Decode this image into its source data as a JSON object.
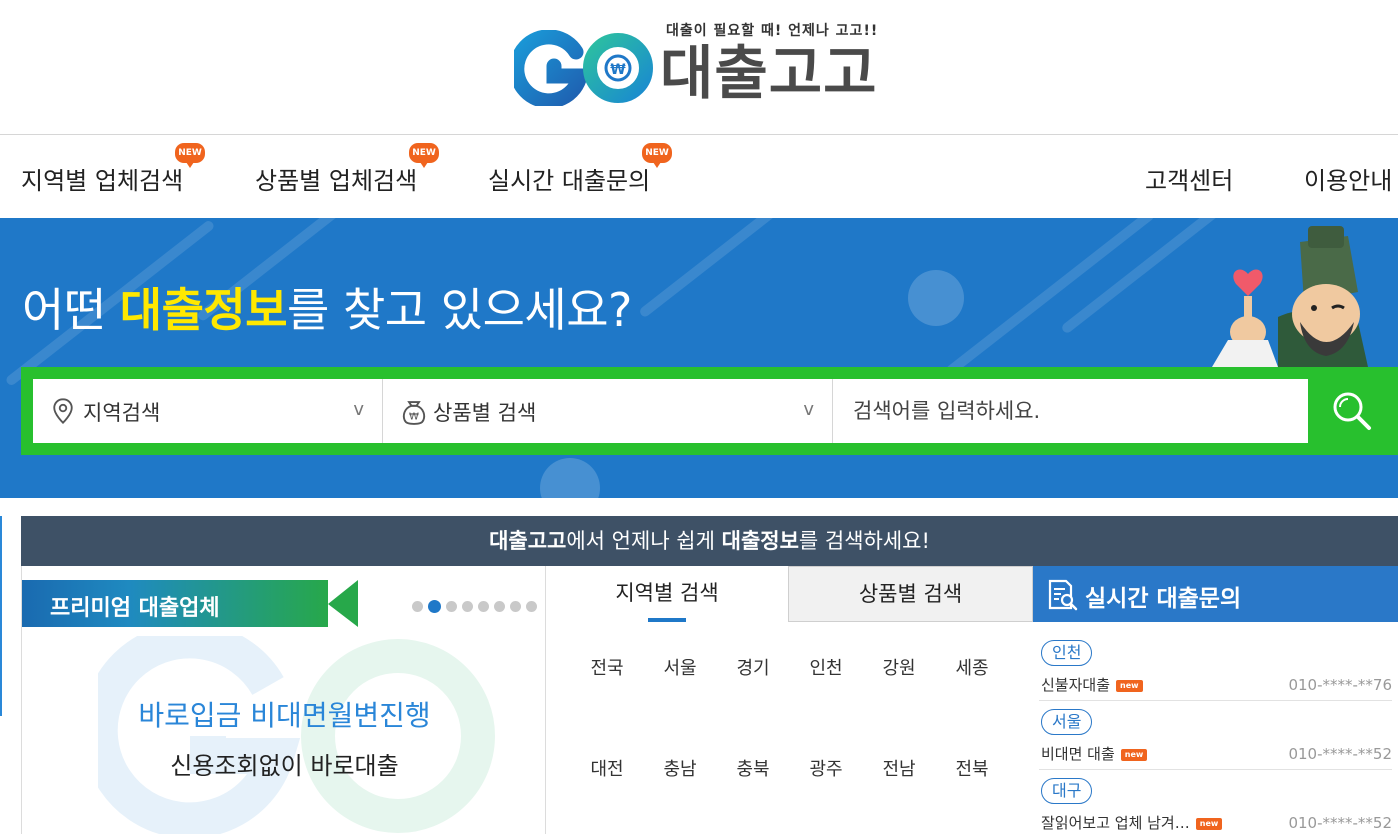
{
  "logo": {
    "mark": "GO",
    "name": "대출고고",
    "tagline": "대출이 필요할 때! 언제나 고고!!"
  },
  "nav": {
    "left_items": [
      {
        "label": "지역별 업체검색",
        "badge": "NEW"
      },
      {
        "label": "상품별 업체검색",
        "badge": "NEW"
      },
      {
        "label": "실시간 대출문의",
        "badge": "NEW"
      }
    ],
    "right_items": [
      {
        "label": "고객센터"
      },
      {
        "label": "이용안내"
      }
    ]
  },
  "hero": {
    "title_pre": "어떤 ",
    "title_highlight": "대출정보",
    "title_post": "를 찾고 있으세요?",
    "search": {
      "region_label": "지역검색",
      "product_label": "상품별 검색",
      "chevron": "v",
      "placeholder": "검색어를 입력하세요."
    }
  },
  "banner": {
    "part1_bold": "대출고고",
    "part2": "에서 언제나 쉽게 ",
    "part3_bold": "대출정보",
    "part4": "를 검색하세요!"
  },
  "premium": {
    "label": "프리미엄 대출업체",
    "dots_total": 8,
    "dots_active_index": 1,
    "ad_line1": "바로입금 비대면월변진행",
    "ad_line2": "신용조회없이 바로대출"
  },
  "tabs": {
    "items": [
      {
        "label": "지역별 검색",
        "active": true
      },
      {
        "label": "상품별 검색",
        "active": false
      }
    ],
    "regions_row1": [
      "전국",
      "서울",
      "경기",
      "인천",
      "강원",
      "세종"
    ],
    "regions_row2": [
      "대전",
      "충남",
      "충북",
      "광주",
      "전남",
      "전북"
    ]
  },
  "live": {
    "title": "실시간 대출문의",
    "items": [
      {
        "region": "인천",
        "title": "신불자대출",
        "badge": "new",
        "phone": "010-****-**76"
      },
      {
        "region": "서울",
        "title": "비대면 대출",
        "badge": "new",
        "phone": "010-****-**52"
      },
      {
        "region": "대구",
        "title": "잘읽어보고 업체 남겨…",
        "badge": "new",
        "phone": "010-****-**52"
      }
    ]
  },
  "colors": {
    "brand_blue": "#1f78c8",
    "search_green": "#28c02e",
    "highlight_yellow": "#ffe800",
    "banner_navy": "#3e5166",
    "badge_orange": "#f0641e"
  },
  "icons": {
    "region": "map-pin-icon",
    "product": "money-bag-icon",
    "search": "magnifier-icon",
    "live": "document-search-icon"
  }
}
